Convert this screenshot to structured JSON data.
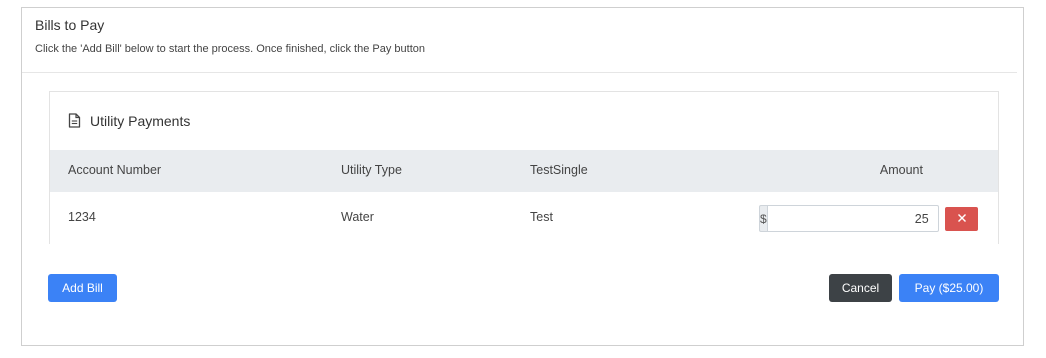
{
  "header": {
    "title": "Bills to Pay",
    "description": "Click the 'Add Bill' below to start the process. Once finished, click the Pay button"
  },
  "card": {
    "title": "Utility Payments",
    "columns": {
      "account_number": "Account Number",
      "utility_type": "Utility Type",
      "test_single": "TestSingle",
      "amount": "Amount"
    },
    "rows": [
      {
        "account_number": "1234",
        "utility_type": "Water",
        "test_single": "Test",
        "currency_symbol": "$",
        "amount": "25"
      }
    ]
  },
  "actions": {
    "add_bill": "Add Bill",
    "cancel": "Cancel",
    "pay": "Pay ($25.00)"
  },
  "icons": {
    "card_title_icon": "document-icon",
    "remove_row_icon": "close-icon"
  },
  "colors": {
    "primary": "#3b82f6",
    "danger": "#d9534f",
    "dark": "#3d4246",
    "table_header_bg": "#e9ecef"
  }
}
